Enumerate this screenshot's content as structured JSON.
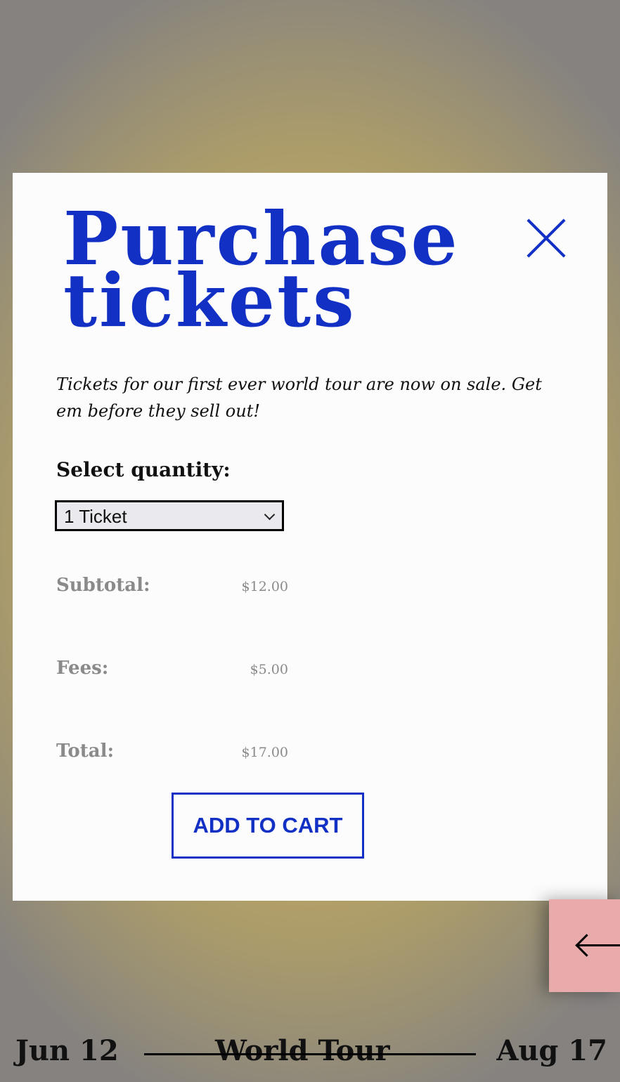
{
  "modal": {
    "title": "Purchase tickets",
    "description": "Tickets for our first ever world tour are now on sale. Get em before they sell out!",
    "quantity_label": "Select quantity:",
    "quantity_selected": "1 Ticket",
    "summary": [
      {
        "label": "Subtotal:",
        "value": "$12.00"
      },
      {
        "label": "Fees:",
        "value": "$5.00"
      },
      {
        "label": "Total:",
        "value": "$17.00"
      }
    ],
    "add_to_cart_label": "ADD TO CART",
    "close_icon": "close-icon"
  },
  "back_button": {
    "icon": "arrow-left-icon"
  },
  "footer": {
    "start_date": "Jun 12",
    "tour_name": "World Tour",
    "end_date": "Aug 17"
  },
  "colors": {
    "accent": "#1231c4",
    "back_tab": "#e8aaaa",
    "muted_text": "#8a8a8a",
    "modal_bg": "#fcfcfc"
  }
}
